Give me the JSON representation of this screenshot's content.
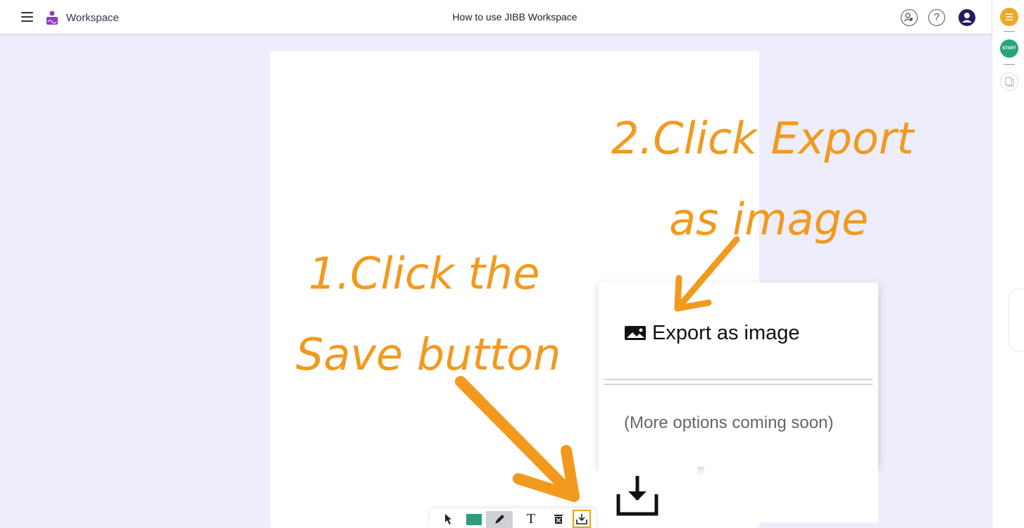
{
  "header": {
    "brand": "Workspace",
    "document_title": "How to use JIBB Workspace"
  },
  "rail": {
    "start_label": "START"
  },
  "export_menu": {
    "export_label": "Export as image",
    "more_options_label": "(More options coming soon)"
  },
  "annotations": {
    "step2_line1": "2.Click Export",
    "step2_line2": "as image",
    "step1_line1": "1.Click the",
    "step1_line2": "Save button"
  },
  "toolbar": {
    "text_tool_glyph": "T",
    "active_color": "#2f9d7a"
  },
  "colors": {
    "annotation_orange": "#f19a1e",
    "brand_purple": "#2a1763",
    "accent_orange": "#f0a825",
    "start_green": "#2aa37a"
  },
  "icons": [
    "menu-icon",
    "workspace-logo-icon",
    "users-icon",
    "help-icon",
    "avatar-icon",
    "rail-menu-icon",
    "page-icon",
    "image-icon",
    "download-icon",
    "pointer-icon",
    "pen-icon",
    "clear-icon"
  ]
}
